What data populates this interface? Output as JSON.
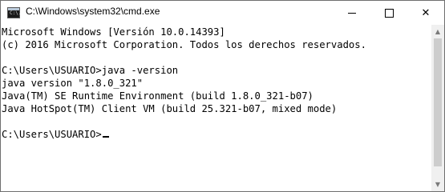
{
  "window": {
    "title": "C:\\Windows\\system32\\cmd.exe",
    "icon": "cmd-icon",
    "icon_text": "C:\\."
  },
  "controls": {
    "minimize": "minimize-icon",
    "maximize": "maximize-icon",
    "close_label": "✕"
  },
  "console": {
    "lines": [
      "Microsoft Windows [Versión 10.0.14393]",
      "(c) 2016 Microsoft Corporation. Todos los derechos reservados.",
      "",
      "C:\\Users\\USUARIO>java -version",
      "java version \"1.8.0_321\"",
      "Java(TM) SE Runtime Environment (build 1.8.0_321-b07)",
      "Java HotSpot(TM) Client VM (build 25.321-b07, mixed mode)",
      "",
      "C:\\Users\\USUARIO>"
    ]
  },
  "scrollbar": {
    "up_arrow": "▲",
    "down_arrow": "▼"
  },
  "colors": {
    "background": "#ffffff",
    "text": "#000000",
    "scrollbar_track": "#f0f0f0",
    "scrollbar_thumb": "#cdcdcd"
  }
}
